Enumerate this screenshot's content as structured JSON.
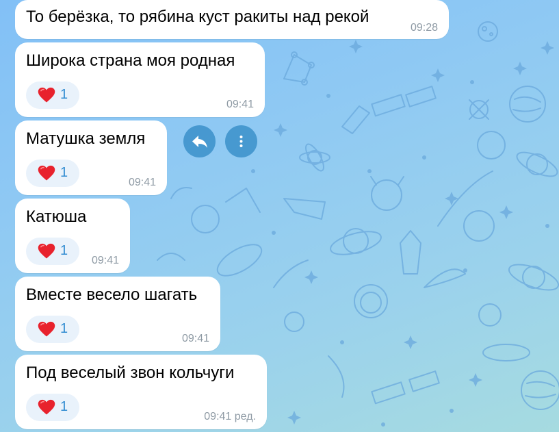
{
  "messages": [
    {
      "text": "То берёзка, то рябина куст ракиты над рекой",
      "time": "09:28"
    },
    {
      "text": "Широка страна моя родная",
      "time": "09:41",
      "reaction": {
        "emoji": "heart",
        "count": "1"
      }
    },
    {
      "text": "Матушка земля",
      "time": "09:41",
      "reaction": {
        "emoji": "heart",
        "count": "1"
      }
    },
    {
      "text": "Катюша",
      "time": "09:41",
      "reaction": {
        "emoji": "heart",
        "count": "1"
      }
    },
    {
      "text": "Вместе весело шагать",
      "time": "09:41",
      "reaction": {
        "emoji": "heart",
        "count": "1"
      }
    },
    {
      "text": "Под веселый звон кольчуги",
      "time": "09:41 ред.",
      "reaction": {
        "emoji": "heart",
        "count": "1"
      }
    }
  ],
  "actions": {
    "reply_icon": "reply-arrow-icon",
    "more_icon": "vertical-dots-icon"
  },
  "colors": {
    "accent": "#2f8bd1",
    "action_bg": "#2f88c4",
    "reaction_bg": "#e9f2fb"
  }
}
